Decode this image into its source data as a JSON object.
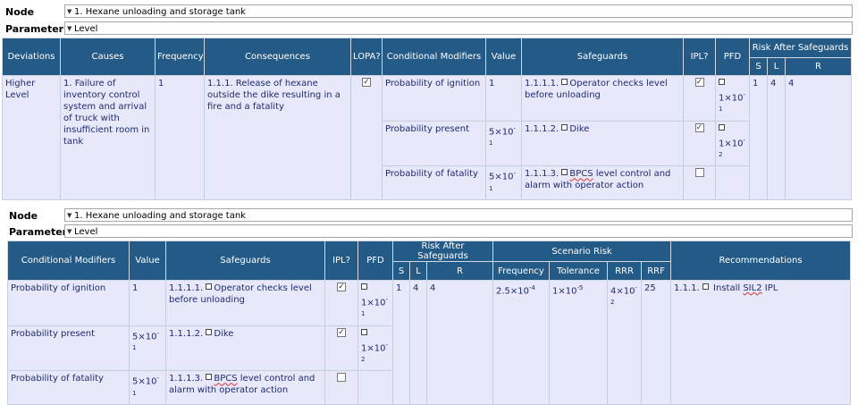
{
  "labels": {
    "node": "Node",
    "parameter": "Parameter"
  },
  "node_value": "1. Hexane unloading and storage tank",
  "parameter_value": "Level",
  "table1": {
    "headers": {
      "deviations": "Deviations",
      "causes": "Causes",
      "frequency": "Frequency",
      "consequences": "Consequences",
      "lopa": "LOPA?",
      "conditional_modifiers": "Conditional Modifiers",
      "value": "Value",
      "safeguards": "Safeguards",
      "ipl": "IPL?",
      "pfd": "PFD",
      "risk_after": "Risk After Safeguards",
      "s": "S",
      "l": "L",
      "r": "R"
    },
    "deviation": "Higher Level",
    "cause": "1. Failure of inventory control system and arrival of truck with insufficient room in tank",
    "frequency": "1",
    "consequence": "1.1.1. Release of hexane outside the dike resulting in a fire and a fatality",
    "s": "1",
    "l": "4",
    "r": "4"
  },
  "table2": {
    "headers": {
      "conditional_modifiers": "Conditional Modifiers",
      "value": "Value",
      "safeguards": "Safeguards",
      "ipl": "IPL?",
      "pfd": "PFD",
      "risk_after": "Risk After Safeguards",
      "s": "S",
      "l": "L",
      "r": "R",
      "scenario_risk": "Scenario Risk",
      "frequency": "Frequency",
      "tolerance": "Tolerance",
      "rrr": "RRR",
      "rrf": "RRF",
      "recommendations": "Recommendations"
    },
    "s": "1",
    "l": "4",
    "r": "4",
    "scenario_frequency": "2.5×10",
    "scenario_frequency_exp": "-4",
    "tolerance": "1×10",
    "tolerance_exp": "-5",
    "rrr": "4×10",
    "rrr_exp": "-2",
    "rrf": "25",
    "recommendation_id": "1.1.1.",
    "recommendation_text": "Install",
    "recommendation_sil": "SIL2",
    "recommendation_tail": "IPL"
  },
  "modifiers": [
    {
      "name": "Probability of ignition",
      "value": "1",
      "value_exp": ""
    },
    {
      "name": "Probability present",
      "value": "5×10",
      "value_exp": "-1"
    },
    {
      "name": "Probability of fatality",
      "value": "5×10",
      "value_exp": "-1"
    }
  ],
  "safeguards": [
    {
      "id": "1.1.1.1.",
      "text": "Operator checks level before unloading",
      "ipl": true,
      "pfd": "1×10",
      "pfd_exp": "-1"
    },
    {
      "id": "1.1.1.2.",
      "text": "Dike",
      "ipl": true,
      "pfd": "1×10",
      "pfd_exp": "-2"
    },
    {
      "id": "1.1.1.3.",
      "text_pre": "BPCS",
      "text": "level control and alarm with operator action",
      "ipl": false,
      "pfd": "",
      "pfd_exp": ""
    }
  ]
}
